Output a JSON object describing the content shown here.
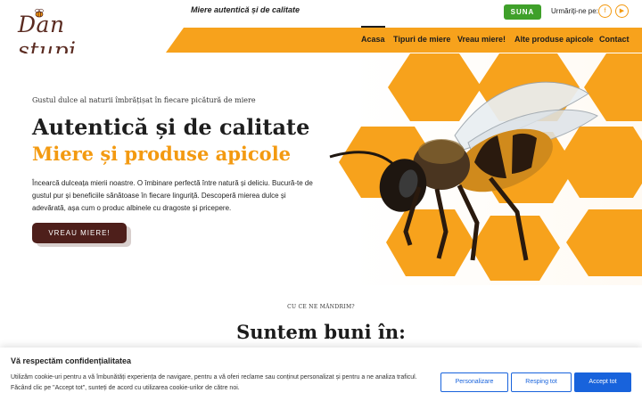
{
  "header": {
    "logo_text": "Dan stupi",
    "tagline": "Miere autentică și de calitate",
    "call_label": "SUNA",
    "follow_label": "Urmăriți-ne pe:",
    "social": [
      "facebook-icon",
      "youtube-icon"
    ],
    "nav": [
      "Acasa",
      "Tipuri de miere",
      "Vreau miere!",
      "Alte produse apicole",
      "Contact"
    ]
  },
  "hero": {
    "subtitle": "Gustul dulce al naturii îmbrățișat în fiecare picătură de miere",
    "title": "Autentică și de calitate",
    "title_highlight": "Miere și produse apicole",
    "description": "Încearcă dulceața mierii noastre. O îmbinare perfectă între natură și deliciu. Bucură-te de gustul pur și beneficiile sănătoase în fiecare linguriță. Descoperă mierea dulce și adevărată, așa cum o produc albinele cu dragoste și pricepere.",
    "cta_label": "VREAU MIERE!"
  },
  "section": {
    "kicker": "CU CE NE MÂNDRIM?",
    "title": "Suntem buni în:"
  },
  "cookie": {
    "title": "Vă respectăm confidențialitatea",
    "text": "Utilizăm cookie-uri pentru a vă îmbunătăți experiența de navigare, pentru a vă oferi reclame sau conținut personalizat și pentru a ne analiza traficul. Făcând clic pe \"Accept tot\", sunteți de acord cu utilizarea cookie-urilor de către noi.",
    "customize_label": "Personalizare",
    "reject_label": "Resping tot",
    "accept_label": "Accept tot"
  },
  "colors": {
    "brand_orange": "#f7a21c",
    "brand_brown": "#4e1f1b",
    "call_green": "#3fa02a",
    "cookie_blue": "#1863dc"
  }
}
